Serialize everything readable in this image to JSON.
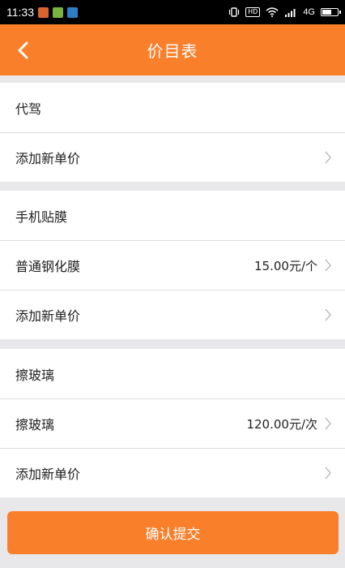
{
  "status_bar": {
    "time": "11:33",
    "hd_label": "HD",
    "network": "4G",
    "battery_level": 0.75,
    "app_icon_colors": [
      "#d9642e",
      "#7ab340",
      "#2d7fc4"
    ]
  },
  "header": {
    "title": "价目表",
    "back_icon": "chevron-left-icon",
    "background": "#fa7f2b"
  },
  "sections": [
    {
      "name": "代驾",
      "items": [],
      "add_label": "添加新单价"
    },
    {
      "name": "手机贴膜",
      "items": [
        {
          "label": "普通钢化膜",
          "price": "15.00元/个"
        }
      ],
      "add_label": "添加新单价"
    },
    {
      "name": "擦玻璃",
      "items": [
        {
          "label": "擦玻璃",
          "price": "120.00元/次"
        }
      ],
      "add_label": "添加新单价"
    }
  ],
  "submit_label": "确认提交",
  "accent_color": "#fa7f2b"
}
